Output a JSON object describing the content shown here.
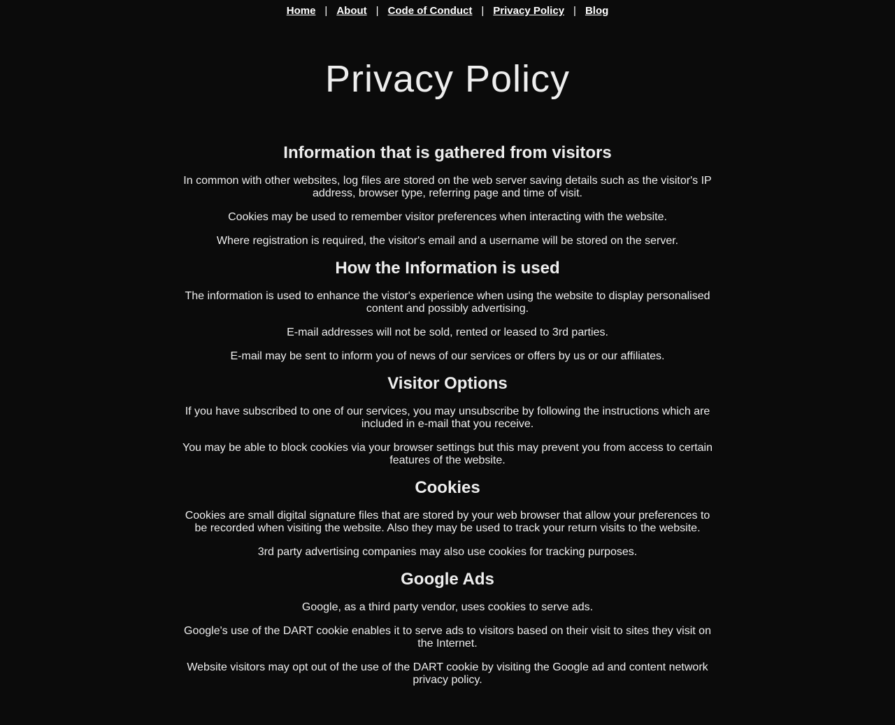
{
  "nav": {
    "items": [
      "Home",
      "About",
      "Code of Conduct",
      "Privacy Policy",
      "Blog"
    ],
    "separator": "|"
  },
  "page": {
    "title": "Privacy Policy"
  },
  "sections": [
    {
      "heading": "Information that is gathered from visitors",
      "paragraphs": [
        "In common with other websites, log files are stored on the web server saving details such as the visitor's IP address, browser type, referring page and time of visit.",
        "Cookies may be used to remember visitor preferences when interacting with the website.",
        "Where registration is required, the visitor's email and a username will be stored on the server."
      ]
    },
    {
      "heading": "How the Information is used",
      "paragraphs": [
        "The information is used to enhance the vistor's experience when using the website to display personalised content and possibly advertising.",
        "E-mail addresses will not be sold, rented or leased to 3rd parties.",
        "E-mail may be sent to inform you of news of our services or offers by us or our affiliates."
      ]
    },
    {
      "heading": "Visitor Options",
      "paragraphs": [
        "If you have subscribed to one of our services, you may unsubscribe by following the instructions which are included in e-mail that you receive.",
        "You may be able to block cookies via your browser settings but this may prevent you from access to certain features of the website."
      ]
    },
    {
      "heading": "Cookies",
      "paragraphs": [
        "Cookies are small digital signature files that are stored by your web browser that allow your preferences to be recorded when visiting the website. Also they may be used to track your return visits to the website.",
        "3rd party advertising companies may also use cookies for tracking purposes."
      ]
    },
    {
      "heading": "Google Ads",
      "paragraphs": [
        "Google, as a third party vendor, uses cookies to serve ads.",
        "Google's use of the DART cookie enables it to serve ads to visitors based on their visit to sites they visit on the Internet.",
        "Website visitors may opt out of the use of the DART cookie by visiting the Google ad and content network privacy policy."
      ]
    }
  ],
  "colors": {
    "background": "#0b0b0b",
    "text": "#eeeeee",
    "link": "#ffffff"
  }
}
